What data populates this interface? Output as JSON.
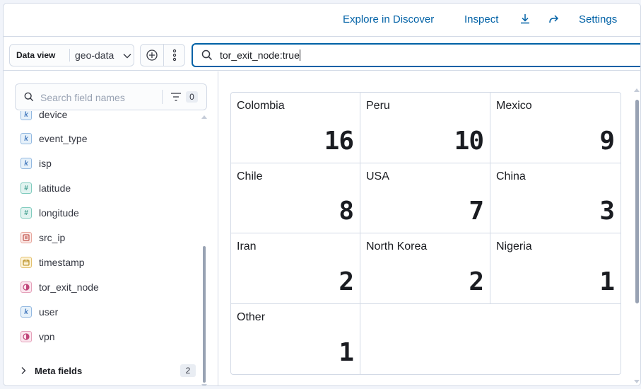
{
  "topbar": {
    "explore_label": "Explore in Discover",
    "inspect_label": "Inspect",
    "settings_label": "Settings",
    "download_icon": "download-icon",
    "share_icon": "share-icon"
  },
  "querybar": {
    "dataview_label": "Data view",
    "dataview_value": "geo-data",
    "query_text": "tor_exit_node:true"
  },
  "sidebar": {
    "search_placeholder": "Search field names",
    "filter_count": "0",
    "fields": [
      {
        "name": "device",
        "type": "keyword",
        "token": "k"
      },
      {
        "name": "event_type",
        "type": "keyword",
        "token": "k"
      },
      {
        "name": "isp",
        "type": "keyword",
        "token": "k"
      },
      {
        "name": "latitude",
        "type": "number",
        "token": "#"
      },
      {
        "name": "longitude",
        "type": "number",
        "token": "#"
      },
      {
        "name": "src_ip",
        "type": "ip",
        "token": "IP"
      },
      {
        "name": "timestamp",
        "type": "date",
        "token": "D"
      },
      {
        "name": "tor_exit_node",
        "type": "boolean",
        "token": "B"
      },
      {
        "name": "user",
        "type": "keyword",
        "token": "k"
      },
      {
        "name": "vpn",
        "type": "boolean",
        "token": "B"
      }
    ],
    "meta_label": "Meta fields",
    "meta_count": "2"
  },
  "metrics": [
    {
      "label": "Colombia",
      "value": "16"
    },
    {
      "label": "Peru",
      "value": "10"
    },
    {
      "label": "Mexico",
      "value": "9"
    },
    {
      "label": "Chile",
      "value": "8"
    },
    {
      "label": "USA",
      "value": "7"
    },
    {
      "label": "China",
      "value": "3"
    },
    {
      "label": "Iran",
      "value": "2"
    },
    {
      "label": "North Korea",
      "value": "2"
    },
    {
      "label": "Nigeria",
      "value": "1"
    },
    {
      "label": "Other",
      "value": "1"
    }
  ],
  "colors": {
    "accent": "#0061a6",
    "border": "#d3dae6",
    "text": "#1a1c21"
  }
}
